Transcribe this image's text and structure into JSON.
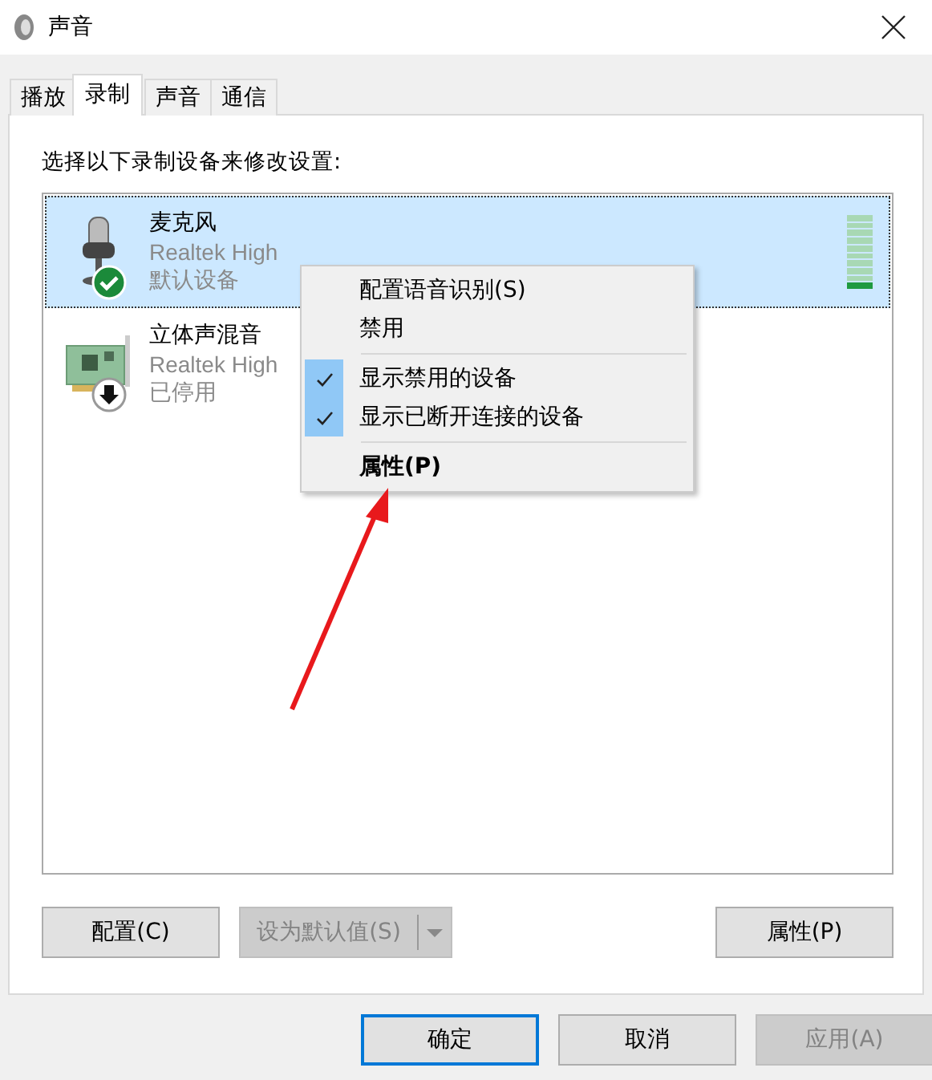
{
  "window": {
    "title": "声音"
  },
  "tabs": [
    {
      "label": "播放",
      "selected": false
    },
    {
      "label": "录制",
      "selected": true
    },
    {
      "label": "声音",
      "selected": false
    },
    {
      "label": "通信",
      "selected": false
    }
  ],
  "instruction": "选择以下录制设备来修改设置:",
  "devices": [
    {
      "name": "麦克风",
      "driver": "Realtek High",
      "status": "默认设备",
      "kind": "microphone",
      "is_default": true,
      "disabled": false,
      "selected": true,
      "level": 0.1
    },
    {
      "name": "立体声混音",
      "driver": "Realtek High",
      "status": "已停用",
      "kind": "soundcard",
      "is_default": false,
      "disabled": true,
      "selected": false
    }
  ],
  "context_menu": {
    "items": [
      {
        "kind": "item",
        "label": "配置语音识别(S)"
      },
      {
        "kind": "item",
        "label": "禁用"
      },
      {
        "kind": "separator"
      },
      {
        "kind": "check",
        "label": "显示禁用的设备",
        "checked": true
      },
      {
        "kind": "check",
        "label": "显示已断开连接的设备",
        "checked": true
      },
      {
        "kind": "separator"
      },
      {
        "kind": "default",
        "label": "属性(P)"
      }
    ]
  },
  "panel_buttons": [
    {
      "label": "配置(C)",
      "kind": "button",
      "disabled": false
    },
    {
      "label": "设为默认值(S)",
      "kind": "split",
      "disabled": true
    },
    {
      "label": "属性(P)",
      "kind": "button",
      "disabled": false
    }
  ],
  "dialog_buttons": [
    {
      "label": "确定",
      "default": true,
      "disabled": false
    },
    {
      "label": "取消",
      "default": false,
      "disabled": false
    },
    {
      "label": "应用(A)",
      "default": false,
      "disabled": true
    }
  ]
}
